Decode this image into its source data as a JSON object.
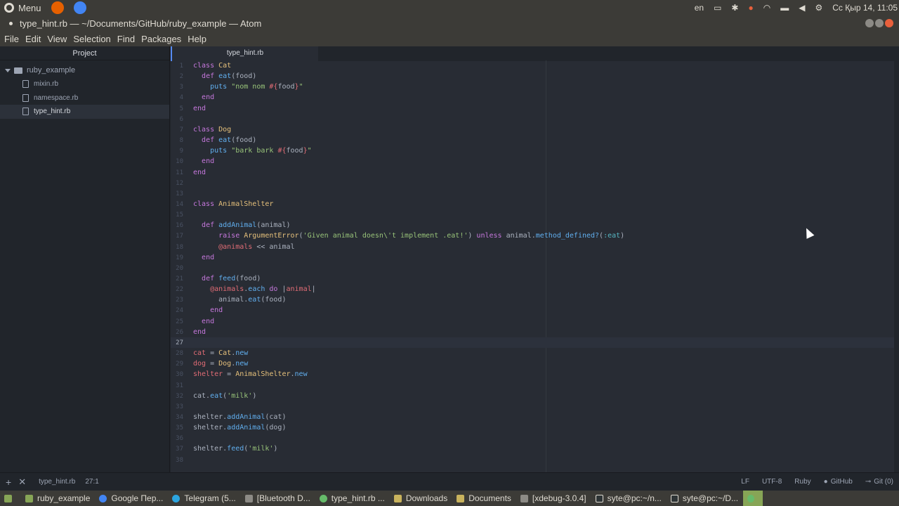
{
  "system_bar": {
    "menu_label": "Menu",
    "lang": "en",
    "clock": "Сс Қыр 14, 11:05"
  },
  "window": {
    "title": "type_hint.rb — ~/Documents/GitHub/ruby_example — Atom"
  },
  "menubar": [
    "File",
    "Edit",
    "View",
    "Selection",
    "Find",
    "Packages",
    "Help"
  ],
  "tree": {
    "header": "Project",
    "root": "ruby_example",
    "files": [
      "mixin.rb",
      "namespace.rb",
      "type_hint.rb"
    ]
  },
  "tab": {
    "label": "type_hint.rb"
  },
  "status": {
    "file": "type_hint.rb",
    "cursor": "27:1",
    "line_ending": "LF",
    "encoding": "UTF-8",
    "grammar": "Ruby",
    "github": "GitHub",
    "git": "Git (0)"
  },
  "taskbar": [
    "ruby_example",
    "Google Пер...",
    "Telegram (5...",
    "[Bluetooth D...",
    "type_hint.rb ...",
    "Downloads",
    "Documents",
    "[xdebug-3.0.4]",
    "syte@pc:~/n...",
    "syte@pc:~/D..."
  ],
  "colors": {
    "accent": "#568af2",
    "editor_bg": "#282c34",
    "panel_bg": "#21252b"
  }
}
